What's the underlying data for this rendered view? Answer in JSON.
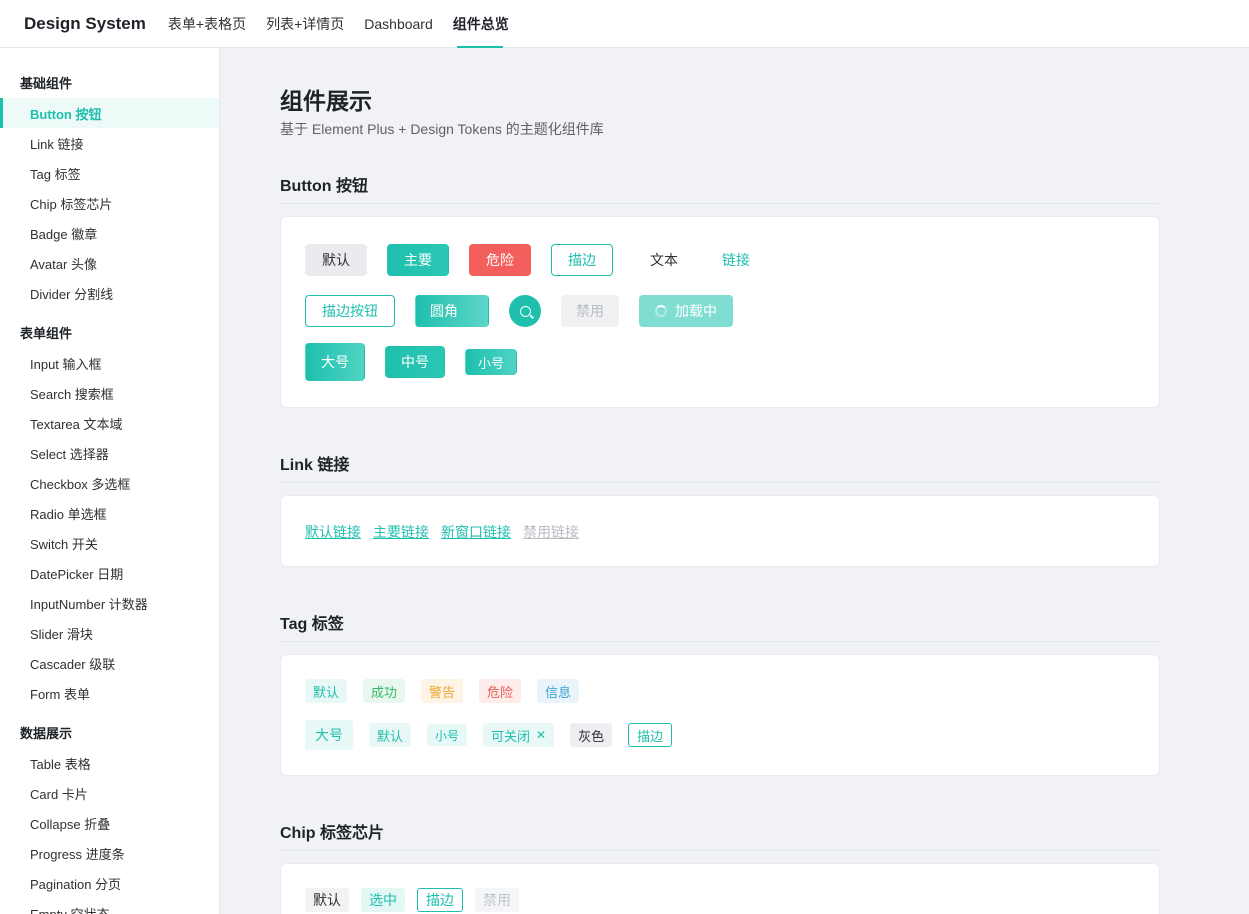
{
  "topnav": {
    "brand": "Design System",
    "items": [
      "表单+表格页",
      "列表+详情页",
      "Dashboard",
      "组件总览"
    ],
    "active_index": 3
  },
  "sidebar": {
    "groups": [
      {
        "title": "基础组件",
        "items": [
          "Button 按钮",
          "Link 链接",
          "Tag 标签",
          "Chip 标签芯片",
          "Badge 徽章",
          "Avatar 头像",
          "Divider 分割线"
        ]
      },
      {
        "title": "表单组件",
        "items": [
          "Input 输入框",
          "Search 搜索框",
          "Textarea 文本域",
          "Select 选择器",
          "Checkbox 多选框",
          "Radio 单选框",
          "Switch 开关",
          "DatePicker 日期",
          "InputNumber 计数器",
          "Slider 滑块",
          "Cascader 级联",
          "Form 表单"
        ]
      },
      {
        "title": "数据展示",
        "items": [
          "Table 表格",
          "Card 卡片",
          "Collapse 折叠",
          "Progress 进度条",
          "Pagination 分页",
          "Empty 空状态"
        ]
      }
    ],
    "active_item": "Button 按钮"
  },
  "main": {
    "title": "组件展示",
    "subtitle": "基于 Element Plus + Design Tokens 的主题化组件库",
    "sections": {
      "button": {
        "title": "Button 按钮",
        "row1": [
          "默认",
          "主要",
          "危险",
          "描边",
          "文本",
          "链接"
        ],
        "row2": {
          "outline": "描边按钮",
          "round": "圆角",
          "disabled": "禁用",
          "loading": "加载中"
        },
        "row3": [
          "大号",
          "中号",
          "小号"
        ]
      },
      "link": {
        "title": "Link 链接",
        "items": [
          "默认链接",
          "主要链接",
          "新窗口链接",
          "禁用链接"
        ]
      },
      "tag": {
        "title": "Tag 标签",
        "row1": [
          "默认",
          "成功",
          "警告",
          "危险",
          "信息"
        ],
        "row2": {
          "large": "大号",
          "default": "默认",
          "small": "小号",
          "closable": "可关闭",
          "gray": "灰色",
          "outline": "描边"
        }
      },
      "chip": {
        "title": "Chip 标签芯片",
        "items": [
          "默认",
          "选中",
          "描边",
          "禁用"
        ]
      }
    }
  },
  "colors": {
    "accent": "#1fbfae",
    "danger": "#f25f5c",
    "success": "#35b86a",
    "warning": "#eea630",
    "info": "#3da0d6"
  },
  "icons": {
    "circle_button": "search-icon",
    "loading": "spinner-icon",
    "closable_tag": "close-icon"
  }
}
